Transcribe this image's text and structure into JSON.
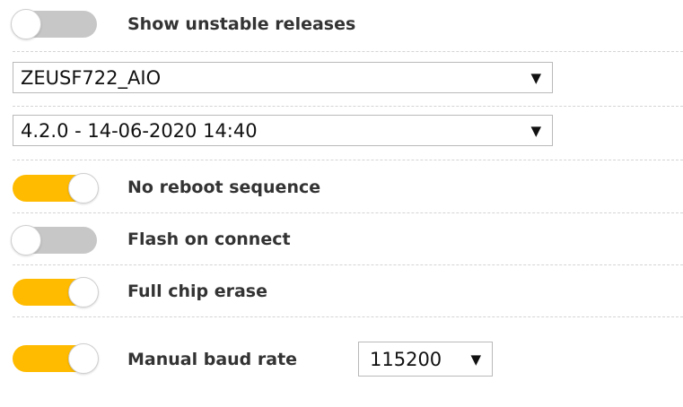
{
  "options": {
    "show_unstable": {
      "label": "Show unstable releases",
      "enabled": false
    },
    "no_reboot": {
      "label": "No reboot sequence",
      "enabled": true
    },
    "flash_on_connect": {
      "label": "Flash on connect",
      "enabled": false
    },
    "full_chip_erase": {
      "label": "Full chip erase",
      "enabled": true
    },
    "manual_baud": {
      "label": "Manual baud rate",
      "enabled": true
    }
  },
  "board_select": {
    "value": "ZEUSF722_AIO"
  },
  "firmware_select": {
    "value": "4.2.0 - 14-06-2020 14:40"
  },
  "baud_select": {
    "value": "115200"
  },
  "icons": {
    "dropdown": "caret-down-icon",
    "caret_glyph": "▼"
  },
  "colors": {
    "toggle_on": "#ffbb00",
    "toggle_off": "#c7c7c7"
  }
}
